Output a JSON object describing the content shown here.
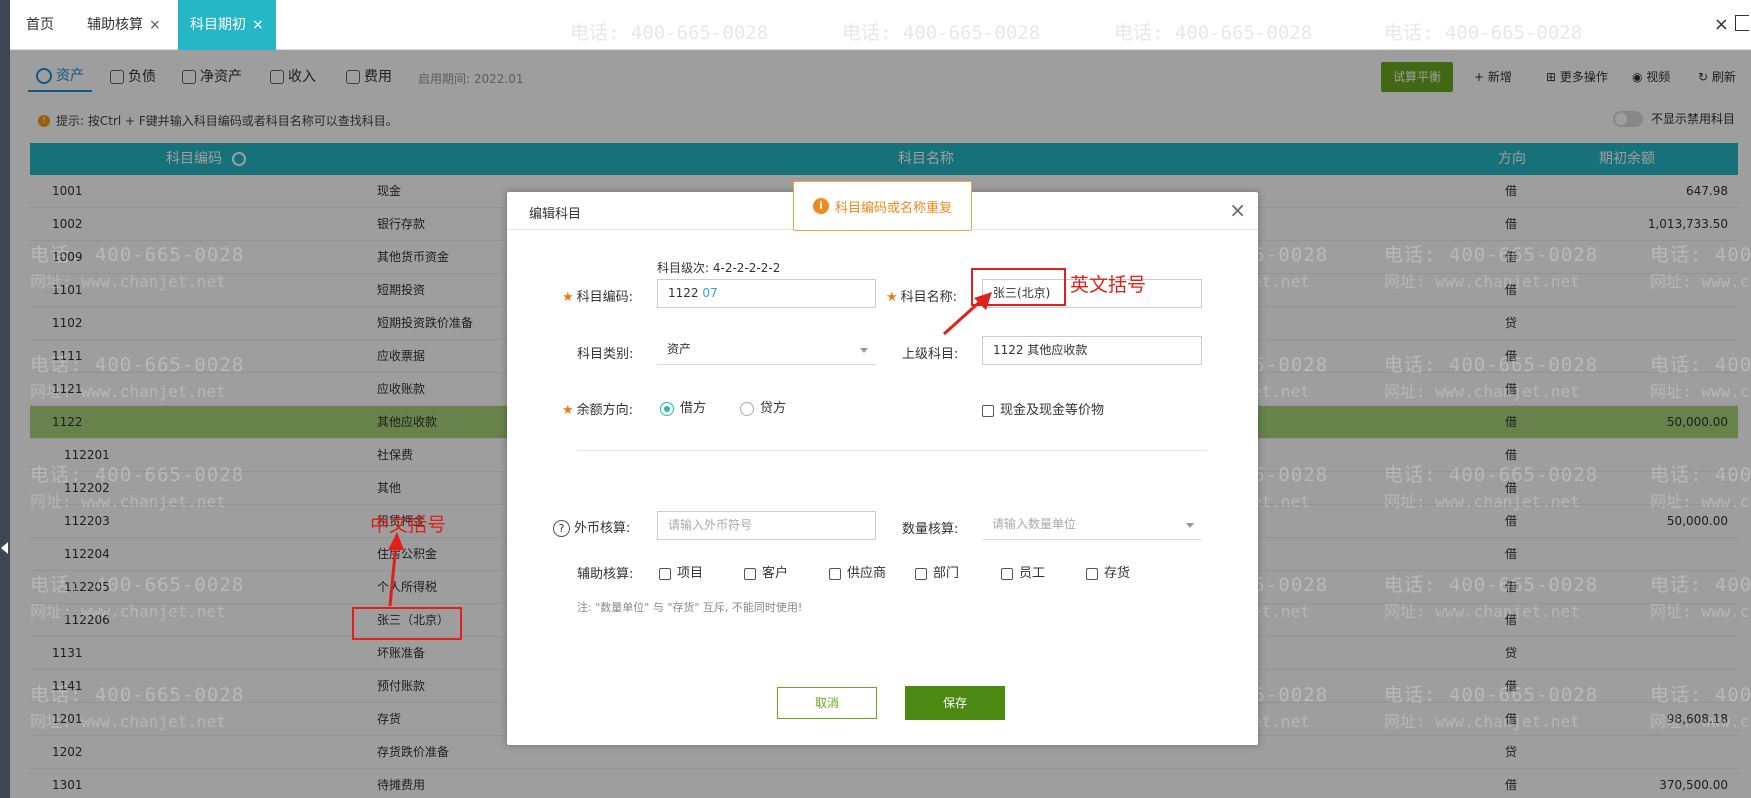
{
  "tabs": [
    {
      "label": "首页",
      "closable": false,
      "active": false
    },
    {
      "label": "辅助核算",
      "closable": true,
      "active": false
    },
    {
      "label": "科目期初",
      "closable": true,
      "active": true
    }
  ],
  "tab_close_glyph": "×",
  "window_close_glyph": "×",
  "toolbar": {
    "categories": [
      "资产",
      "负债",
      "净资产",
      "收入",
      "费用"
    ],
    "period": "启用期间: 2022.01",
    "trial_balance": "试算平衡",
    "add": "+ 新增",
    "more": "更多操作",
    "video": "视频",
    "refresh": "刷新"
  },
  "tip": "提示: 按Ctrl + F键并输入科目编码或者科目名称可以查找科目。",
  "toggle_label": "不显示禁用科目",
  "table": {
    "headers": {
      "code": "科目编码",
      "name": "科目名称",
      "direction": "方向",
      "balance": "期初余额"
    },
    "rows": [
      {
        "code": "1001",
        "name": "现金",
        "dir": "借",
        "bal": "647.98"
      },
      {
        "code": "1002",
        "name": "银行存款",
        "dir": "借",
        "bal": "1,013,733.50"
      },
      {
        "code": "1009",
        "name": "其他货币资金",
        "dir": "借",
        "bal": ""
      },
      {
        "code": "1101",
        "name": "短期投资",
        "dir": "借",
        "bal": ""
      },
      {
        "code": "1102",
        "name": "短期投资跌价准备",
        "dir": "贷",
        "bal": ""
      },
      {
        "code": "1111",
        "name": "应收票据",
        "dir": "借",
        "bal": ""
      },
      {
        "code": "1121",
        "name": "应收账款",
        "dir": "借",
        "bal": ""
      },
      {
        "code": "1122",
        "name": "其他应收款",
        "dir": "借",
        "bal": "50,000.00"
      },
      {
        "code": "112201",
        "name": "社保费",
        "dir": "借",
        "bal": ""
      },
      {
        "code": "112202",
        "name": "其他",
        "dir": "借",
        "bal": ""
      },
      {
        "code": "112203",
        "name": "租赁押金",
        "dir": "借",
        "bal": "50,000.00"
      },
      {
        "code": "112204",
        "name": "住房公积金",
        "dir": "借",
        "bal": ""
      },
      {
        "code": "112205",
        "name": "个人所得税",
        "dir": "借",
        "bal": ""
      },
      {
        "code": "112206",
        "name": "张三（北京）",
        "dir": "借",
        "bal": ""
      },
      {
        "code": "1131",
        "name": "坏账准备",
        "dir": "贷",
        "bal": ""
      },
      {
        "code": "1141",
        "name": "预付账款",
        "dir": "借",
        "bal": ""
      },
      {
        "code": "1201",
        "name": "存货",
        "dir": "借",
        "bal": "98,608.18"
      },
      {
        "code": "1202",
        "name": "存货跌价准备",
        "dir": "贷",
        "bal": ""
      },
      {
        "code": "1301",
        "name": "待摊费用",
        "dir": "借",
        "bal": "370,500.00"
      }
    ]
  },
  "modal": {
    "title": "编辑科目",
    "close": "×",
    "level_label": "科目级次:",
    "level_value": "4-2-2-2-2-2",
    "code_label": "科目编码:",
    "code_prefix": "1122",
    "code_suffix": "07",
    "name_label": "科目名称:",
    "name_value": "张三(北京)",
    "category_label": "科目类别:",
    "category_value": "资产",
    "parent_label": "上级科目:",
    "parent_value": "1122 其他应收款",
    "direction_label": "余额方向:",
    "debit": "借方",
    "credit": "贷方",
    "cash_label": "现金及现金等价物",
    "currency_label": "外币核算:",
    "currency_placeholder": "请输入外币符号",
    "quantity_label": "数量核算:",
    "quantity_placeholder": "请输入数量单位",
    "aux_label": "辅助核算:",
    "aux_items": [
      "项目",
      "客户",
      "供应商",
      "部门",
      "员工",
      "存货"
    ],
    "note": "注: \"数量单位\" 与 \"存货\" 互斥, 不能同时使用!",
    "cancel": "取消",
    "save": "保存"
  },
  "toast": "科目编码或名称重复",
  "annotations": {
    "english_paren": "英文括号",
    "chinese_paren": "中文括号"
  },
  "watermark": {
    "phone": "电话: 400-665-0028",
    "site": "网址: www.chanjet.net"
  },
  "colors": {
    "tab_active": "#25b7c5",
    "selected_row": "#a7d37a",
    "save": "#4a8a13",
    "toast": "#f08a1a",
    "annotation": "#e0201a"
  }
}
